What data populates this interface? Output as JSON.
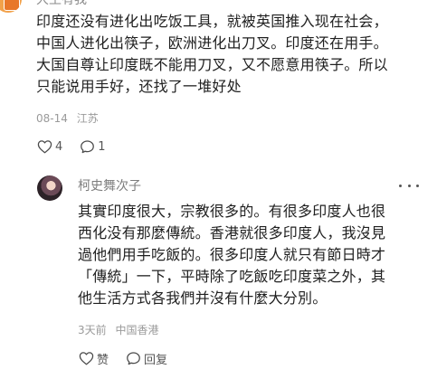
{
  "top_comment": {
    "name": "大王有我",
    "lines": [
      "印度还没有进化出吃饭工具，就被英国推入现在社会，",
      "中国人进化出筷子，欧洲进化出刀叉。印度还在用手。",
      "大国自尊让印度既不能用刀叉，又不愿意用筷子。所以",
      "只能说用手好，还找了一堆好处"
    ],
    "date": "08-14",
    "location": "江苏",
    "like_count": "4",
    "reply_count": "1"
  },
  "reply": {
    "name": "柯史舞次子",
    "lines": [
      "其實印度很大，宗教很多的。有很多印度人也很",
      "西化没有那麼傳統。香港就很多印度人，我沒見",
      "過他們用手吃飯的。很多印度人就只有節日時才",
      "「傳統」一下，平時除了吃飯吃印度菜之外，其",
      "他生活方式各我們并沒有什麼大分別。"
    ],
    "time": "3天前",
    "location": "中国香港",
    "like_label": "赞",
    "reply_label": "回复"
  },
  "icons": {
    "heart": "heart-outline-icon",
    "comment": "speech-bubble-icon",
    "more": "more-horizontal-icon"
  }
}
